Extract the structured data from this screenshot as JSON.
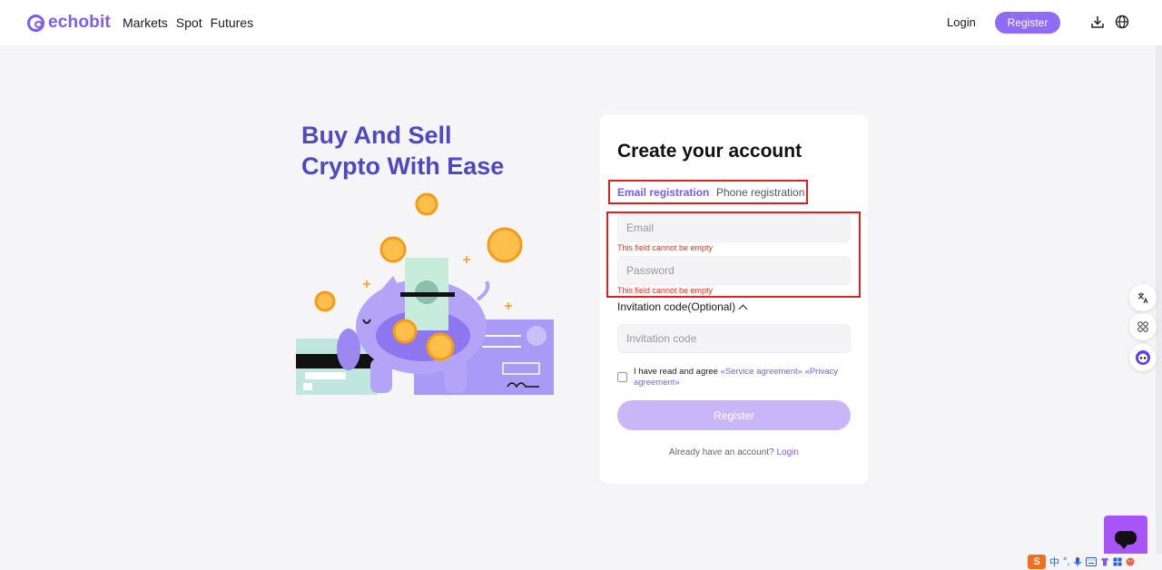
{
  "brand": {
    "name": "echobit",
    "color": "#7b5cf5"
  },
  "nav": {
    "items": [
      "Markets",
      "Spot",
      "Futures"
    ]
  },
  "header": {
    "login_label": "Login",
    "register_label": "Register",
    "icons": [
      "download-icon",
      "globe-icon"
    ]
  },
  "hero": {
    "title_line1": "Buy And Sell",
    "title_line2": "Crypto With Ease"
  },
  "form": {
    "title": "Create your account",
    "tabs": [
      {
        "label": "Email registration",
        "active": true
      },
      {
        "label": "Phone registration",
        "active": false
      }
    ],
    "email": {
      "placeholder": "Email",
      "value": "",
      "error": "This field cannot be empty"
    },
    "password": {
      "placeholder": "Password",
      "value": "",
      "error": "This field cannot be empty"
    },
    "invitation": {
      "label": "Invitation code(Optional)",
      "placeholder": "Invitation code"
    },
    "agreement": {
      "prefix": "I have read and agree",
      "service_link": "«Service agreement»",
      "privacy_link": "«Privacy agreement»",
      "checked": false
    },
    "submit_label": "Register",
    "already_text": "Already have an account?",
    "login_link": "Login"
  },
  "side_widgets": [
    "translate-icon",
    "apps-icon",
    "assistant-icon"
  ],
  "taskbar": {
    "ime_badge": "S",
    "ime_text": "中",
    "punct": "°,"
  },
  "colors": {
    "accent": "#7b5cf5",
    "hero_title": "#5047c4",
    "error": "#e02020",
    "submit_disabled": "#c9b6f9",
    "chat": "#a855f7"
  }
}
